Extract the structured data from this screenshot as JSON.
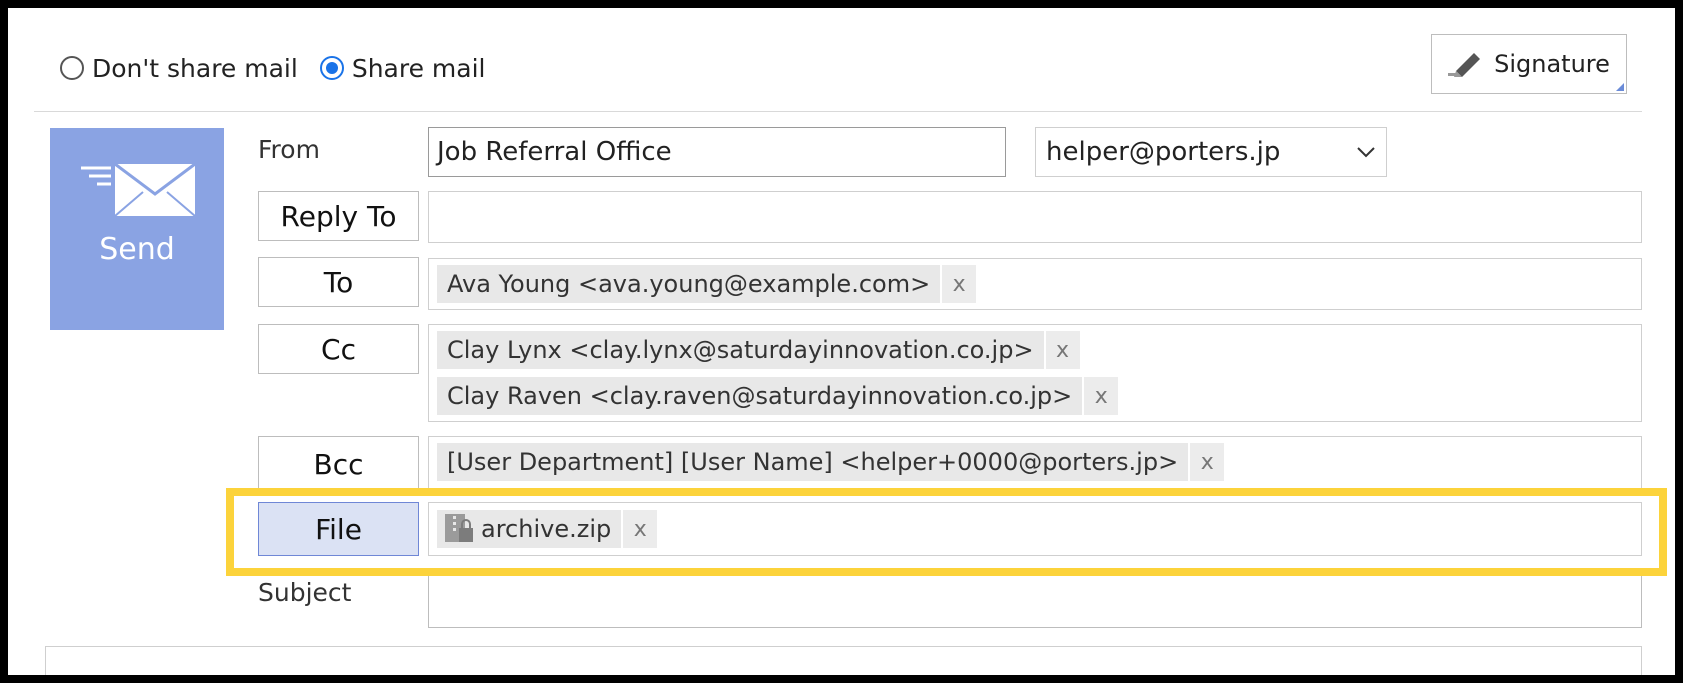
{
  "share": {
    "options": [
      {
        "label": "Don't share mail",
        "checked": false
      },
      {
        "label": "Share mail",
        "checked": true
      }
    ]
  },
  "signature": {
    "label": "Signature",
    "icon": "pen-icon"
  },
  "send": {
    "label": "Send",
    "icon": "envelope-icon",
    "color": "#8aa3e3"
  },
  "from": {
    "label": "From",
    "name_value": "Job Referral Office",
    "address_selected": "helper@porters.jp"
  },
  "reply_to": {
    "label": "Reply To"
  },
  "to": {
    "label": "To",
    "chips": [
      "Ava Young <ava.young@example.com>"
    ]
  },
  "cc": {
    "label": "Cc",
    "chips": [
      "Clay Lynx <clay.lynx@saturdayinnovation.co.jp>",
      "Clay Raven <clay.raven@saturdayinnovation.co.jp>"
    ]
  },
  "bcc": {
    "label": "Bcc",
    "chips": [
      "[User Department] [User Name] <helper+0000@porters.jp>"
    ]
  },
  "file": {
    "label": "File",
    "chips": [
      "archive.zip"
    ],
    "icon": "zip-file-icon"
  },
  "subject": {
    "label": "Subject",
    "value": ""
  },
  "remove_glyph": "x",
  "highlight_color": "#fcd33b"
}
